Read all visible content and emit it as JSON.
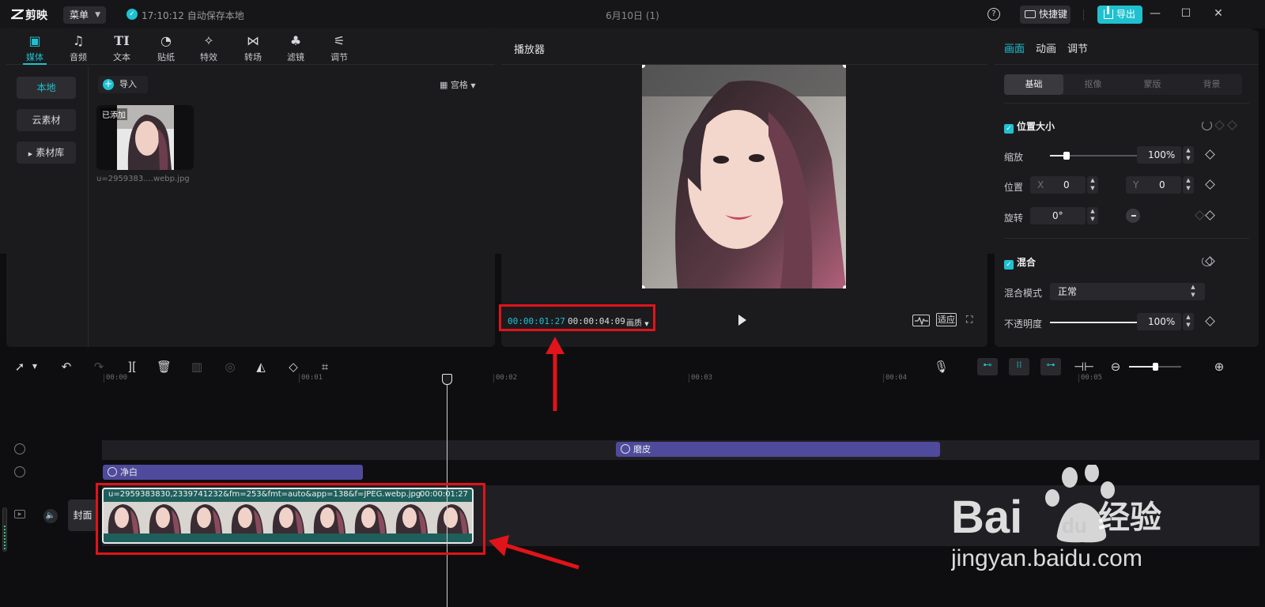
{
  "titlebar": {
    "brand": "剪映",
    "menu_label": "菜单",
    "autosave": "17:10:12 自动保存本地",
    "document_title": "6月10日 (1)",
    "shortcut_label": "快捷键",
    "export_label": "导出"
  },
  "media_panel": {
    "tabs": [
      {
        "label": "媒体",
        "icon": "media-icon",
        "active": true
      },
      {
        "label": "音频",
        "icon": "audio-icon"
      },
      {
        "label": "文本",
        "icon": "text-icon"
      },
      {
        "label": "贴纸",
        "icon": "sticker-icon"
      },
      {
        "label": "特效",
        "icon": "effects-icon"
      },
      {
        "label": "转场",
        "icon": "transition-icon"
      },
      {
        "label": "滤镜",
        "icon": "filter-icon"
      },
      {
        "label": "调节",
        "icon": "adjust-icon"
      }
    ],
    "side": [
      {
        "label": "本地",
        "active": true
      },
      {
        "label": "云素材"
      },
      {
        "label": "素材库"
      }
    ],
    "import_label": "导入",
    "view_label": "宫格",
    "thumbnail": {
      "badge": "已添加",
      "filename": "u=2959383....webp.jpg"
    }
  },
  "player": {
    "title": "播放器",
    "current_time": "00:00:01:27",
    "total_time": "00:00:04:09",
    "quality_label": "画质",
    "fit_label": "适应"
  },
  "properties": {
    "tabs": [
      "画面",
      "动画",
      "调节"
    ],
    "subtabs": [
      "基础",
      "抠像",
      "蒙版",
      "背景"
    ],
    "position_size": {
      "title": "位置大小",
      "scale_label": "缩放",
      "scale_value": "100%",
      "scale_fraction": 0.18,
      "position_label": "位置",
      "x_label": "X",
      "x_value": "0",
      "y_label": "Y",
      "y_value": "0",
      "rotate_label": "旋转",
      "rotate_value": "0°"
    },
    "blend": {
      "title": "混合",
      "mode_label": "混合模式",
      "mode_value": "正常",
      "opacity_label": "不透明度",
      "opacity_value": "100%",
      "opacity_fraction": 1.0
    }
  },
  "timeline": {
    "ruler": [
      "00:00",
      "00:01",
      "00:02",
      "00:03",
      "00:04",
      "00:05"
    ],
    "effect_clips": [
      {
        "label": "磨皮"
      },
      {
        "label": "净白"
      }
    ],
    "cover_label": "封面",
    "video_clip": {
      "name": "u=2959383830,2339741232&fm=253&fmt=auto&app=138&f=JPEG.webp.jpg",
      "duration": "00:00:01:27"
    }
  },
  "colors": {
    "accent": "#1fc1d1",
    "annotation_red": "#e0141a",
    "effect_clip": "#4f4a9c",
    "video_clip": "#1e5f5c"
  }
}
